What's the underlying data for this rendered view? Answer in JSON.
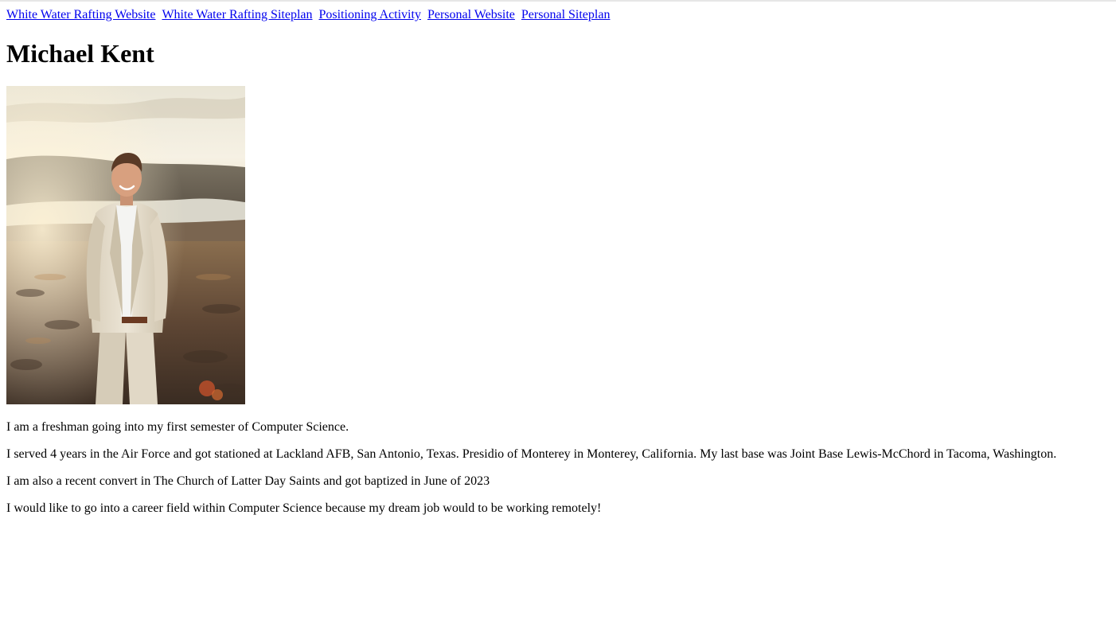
{
  "nav": {
    "links": [
      "White Water Rafting Website",
      "White Water Rafting Siteplan",
      "Positioning Activity",
      "Personal Website",
      "Personal Siteplan"
    ]
  },
  "header": {
    "name": "Michael Kent"
  },
  "photo": {
    "alt": "Portrait of Michael Kent in a light beige suit standing on a hillside above a river at sunset",
    "colors": {
      "sky": "#f3ede0",
      "hills": "#6a5a4a",
      "river": "#d8d6cc",
      "suit": "#e4dccb",
      "ground": "#5b4636"
    }
  },
  "bio": {
    "paragraphs": [
      "I am a freshman going into my first semester of Computer Science.",
      "I served 4 years in the Air Force and got stationed at Lackland AFB, San Antonio, Texas. Presidio of Monterey in Monterey, California. My last base was Joint Base Lewis-McChord in Tacoma, Washington.",
      "I am also a recent convert in The Church of Latter Day Saints and got baptized in June of 2023",
      "I would like to go into a career field within Computer Science because my dream job would to be working remotely!"
    ]
  }
}
